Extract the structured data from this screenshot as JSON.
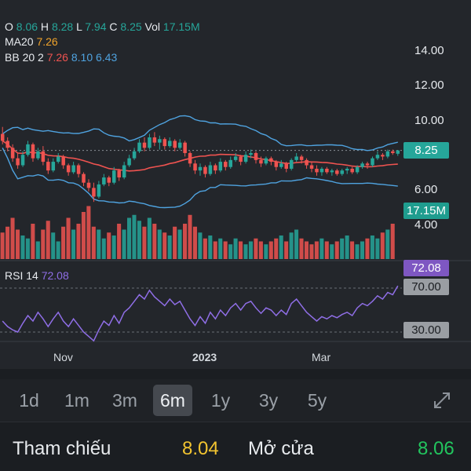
{
  "ohlc": {
    "o_label": "O",
    "o_value": "8.06",
    "h_label": "H",
    "h_value": "8.28",
    "l_label": "L",
    "l_value": "7.94",
    "c_label": "C",
    "c_value": "8.25",
    "vol_label": "Vol",
    "vol_value": "17.15M"
  },
  "ma": {
    "label": "MA20",
    "value": "7.26"
  },
  "bb": {
    "label": "BB 20 2",
    "mid": "7.26",
    "upper": "8.10",
    "lower": "6.43"
  },
  "rsi": {
    "label": "RSI 14",
    "value": "72.08"
  },
  "price_axis": [
    "14.00",
    "12.00",
    "10.00",
    "6.00",
    "4.00"
  ],
  "tags": {
    "price": "8.25",
    "volume": "17.15M",
    "rsi": "72.08",
    "rsi_upper": "70.00",
    "rsi_lower": "30.00"
  },
  "x_axis": [
    "Nov",
    "2023",
    "Mar"
  ],
  "ranges": [
    "1d",
    "1m",
    "3m",
    "6m",
    "1y",
    "3y",
    "5y"
  ],
  "active_range": "6m",
  "info": {
    "ref_label": "Tham chiếu",
    "ref_value": "8.04",
    "open_label": "Mở cửa",
    "open_value": "8.06"
  },
  "colors": {
    "up": "#26a69a",
    "down": "#ef5350",
    "ma": "#ef5350",
    "bb": "#4fa3e0",
    "rsi": "#8f6ee6",
    "price_tag": "#26a69a",
    "rsi_tag": "#7e57c2",
    "ref": "#f2c430",
    "open": "#22c55e"
  },
  "icons": {
    "expand": "expand-icon"
  },
  "chart_data": {
    "type": "candlestick",
    "title": "",
    "x_ticks": [
      "Nov",
      "2023",
      "Mar"
    ],
    "y_ticks": [
      4,
      6,
      10,
      12,
      14
    ],
    "ylim": [
      3,
      15.2
    ],
    "candles": [
      {
        "o": 9.2,
        "h": 9.6,
        "l": 8.6,
        "c": 8.8
      },
      {
        "o": 8.8,
        "h": 9.0,
        "l": 8.2,
        "c": 8.4
      },
      {
        "o": 8.4,
        "h": 8.6,
        "l": 7.6,
        "c": 7.8
      },
      {
        "o": 7.8,
        "h": 8.1,
        "l": 7.2,
        "c": 7.4
      },
      {
        "o": 7.4,
        "h": 8.2,
        "l": 7.3,
        "c": 8.0
      },
      {
        "o": 8.0,
        "h": 8.8,
        "l": 7.9,
        "c": 8.6
      },
      {
        "o": 8.6,
        "h": 8.7,
        "l": 7.6,
        "c": 7.8
      },
      {
        "o": 7.8,
        "h": 8.4,
        "l": 7.7,
        "c": 8.2
      },
      {
        "o": 8.2,
        "h": 8.5,
        "l": 7.4,
        "c": 7.6
      },
      {
        "o": 7.6,
        "h": 7.8,
        "l": 6.9,
        "c": 7.1
      },
      {
        "o": 7.1,
        "h": 7.8,
        "l": 7.0,
        "c": 7.6
      },
      {
        "o": 7.6,
        "h": 8.1,
        "l": 7.5,
        "c": 7.9
      },
      {
        "o": 7.9,
        "h": 8.0,
        "l": 7.2,
        "c": 7.4
      },
      {
        "o": 7.4,
        "h": 7.5,
        "l": 6.8,
        "c": 7.0
      },
      {
        "o": 7.0,
        "h": 7.6,
        "l": 6.9,
        "c": 7.4
      },
      {
        "o": 7.4,
        "h": 7.5,
        "l": 6.7,
        "c": 6.9
      },
      {
        "o": 6.9,
        "h": 7.0,
        "l": 6.2,
        "c": 6.4
      },
      {
        "o": 6.4,
        "h": 6.6,
        "l": 5.9,
        "c": 6.1
      },
      {
        "o": 6.1,
        "h": 6.4,
        "l": 5.3,
        "c": 5.6
      },
      {
        "o": 5.6,
        "h": 6.5,
        "l": 5.5,
        "c": 6.3
      },
      {
        "o": 6.3,
        "h": 6.9,
        "l": 6.2,
        "c": 6.7
      },
      {
        "o": 6.7,
        "h": 6.8,
        "l": 6.2,
        "c": 6.4
      },
      {
        "o": 6.4,
        "h": 7.3,
        "l": 6.3,
        "c": 7.1
      },
      {
        "o": 7.1,
        "h": 7.2,
        "l": 6.5,
        "c": 6.7
      },
      {
        "o": 6.7,
        "h": 7.6,
        "l": 6.6,
        "c": 7.4
      },
      {
        "o": 7.4,
        "h": 8.0,
        "l": 7.3,
        "c": 7.8
      },
      {
        "o": 7.8,
        "h": 8.4,
        "l": 7.7,
        "c": 8.2
      },
      {
        "o": 8.2,
        "h": 8.9,
        "l": 8.1,
        "c": 8.7
      },
      {
        "o": 8.7,
        "h": 9.0,
        "l": 8.2,
        "c": 8.4
      },
      {
        "o": 8.4,
        "h": 9.2,
        "l": 8.3,
        "c": 9.0
      },
      {
        "o": 9.0,
        "h": 9.3,
        "l": 8.5,
        "c": 8.7
      },
      {
        "o": 8.7,
        "h": 9.1,
        "l": 8.3,
        "c": 8.9
      },
      {
        "o": 8.9,
        "h": 9.0,
        "l": 8.3,
        "c": 8.5
      },
      {
        "o": 8.5,
        "h": 9.0,
        "l": 8.4,
        "c": 8.8
      },
      {
        "o": 8.8,
        "h": 8.9,
        "l": 8.2,
        "c": 8.4
      },
      {
        "o": 8.4,
        "h": 8.9,
        "l": 8.3,
        "c": 8.7
      },
      {
        "o": 8.7,
        "h": 8.8,
        "l": 7.9,
        "c": 8.1
      },
      {
        "o": 8.1,
        "h": 8.2,
        "l": 7.3,
        "c": 7.5
      },
      {
        "o": 7.5,
        "h": 7.7,
        "l": 6.9,
        "c": 7.1
      },
      {
        "o": 7.1,
        "h": 7.5,
        "l": 6.8,
        "c": 7.3
      },
      {
        "o": 7.3,
        "h": 7.4,
        "l": 6.7,
        "c": 6.9
      },
      {
        "o": 6.9,
        "h": 7.6,
        "l": 6.8,
        "c": 7.4
      },
      {
        "o": 7.4,
        "h": 7.5,
        "l": 6.9,
        "c": 7.1
      },
      {
        "o": 7.1,
        "h": 7.8,
        "l": 7.0,
        "c": 7.6
      },
      {
        "o": 7.6,
        "h": 7.7,
        "l": 7.1,
        "c": 7.3
      },
      {
        "o": 7.3,
        "h": 7.9,
        "l": 7.2,
        "c": 7.7
      },
      {
        "o": 7.7,
        "h": 8.1,
        "l": 7.6,
        "c": 7.9
      },
      {
        "o": 7.9,
        "h": 8.0,
        "l": 7.4,
        "c": 7.6
      },
      {
        "o": 7.6,
        "h": 8.2,
        "l": 7.5,
        "c": 8.0
      },
      {
        "o": 8.0,
        "h": 8.3,
        "l": 7.8,
        "c": 8.1
      },
      {
        "o": 8.1,
        "h": 8.2,
        "l": 7.5,
        "c": 7.7
      },
      {
        "o": 7.7,
        "h": 7.9,
        "l": 7.3,
        "c": 7.5
      },
      {
        "o": 7.5,
        "h": 7.9,
        "l": 7.4,
        "c": 7.8
      },
      {
        "o": 7.8,
        "h": 7.9,
        "l": 7.4,
        "c": 7.6
      },
      {
        "o": 7.6,
        "h": 7.7,
        "l": 7.1,
        "c": 7.3
      },
      {
        "o": 7.3,
        "h": 7.7,
        "l": 7.2,
        "c": 7.5
      },
      {
        "o": 7.5,
        "h": 7.6,
        "l": 7.0,
        "c": 7.2
      },
      {
        "o": 7.2,
        "h": 7.8,
        "l": 7.1,
        "c": 7.7
      },
      {
        "o": 7.7,
        "h": 8.1,
        "l": 7.6,
        "c": 7.9
      },
      {
        "o": 7.9,
        "h": 8.0,
        "l": 7.5,
        "c": 7.7
      },
      {
        "o": 7.7,
        "h": 7.8,
        "l": 7.2,
        "c": 7.4
      },
      {
        "o": 7.4,
        "h": 7.6,
        "l": 7.0,
        "c": 7.2
      },
      {
        "o": 7.2,
        "h": 7.4,
        "l": 6.8,
        "c": 7.0
      },
      {
        "o": 7.0,
        "h": 7.3,
        "l": 6.8,
        "c": 7.2
      },
      {
        "o": 7.2,
        "h": 7.3,
        "l": 6.9,
        "c": 7.0
      },
      {
        "o": 7.0,
        "h": 7.2,
        "l": 6.8,
        "c": 7.1
      },
      {
        "o": 7.1,
        "h": 7.2,
        "l": 6.8,
        "c": 6.9
      },
      {
        "o": 6.9,
        "h": 7.2,
        "l": 6.8,
        "c": 7.1
      },
      {
        "o": 7.1,
        "h": 7.3,
        "l": 6.9,
        "c": 7.2
      },
      {
        "o": 7.2,
        "h": 7.3,
        "l": 6.9,
        "c": 7.0
      },
      {
        "o": 7.0,
        "h": 7.4,
        "l": 6.9,
        "c": 7.3
      },
      {
        "o": 7.3,
        "h": 7.6,
        "l": 7.2,
        "c": 7.5
      },
      {
        "o": 7.5,
        "h": 7.6,
        "l": 7.2,
        "c": 7.4
      },
      {
        "o": 7.4,
        "h": 7.9,
        "l": 7.3,
        "c": 7.8
      },
      {
        "o": 7.8,
        "h": 8.2,
        "l": 7.7,
        "c": 8.0
      },
      {
        "o": 8.0,
        "h": 8.1,
        "l": 7.7,
        "c": 7.9
      },
      {
        "o": 7.9,
        "h": 8.3,
        "l": 7.8,
        "c": 8.2
      },
      {
        "o": 8.2,
        "h": 8.3,
        "l": 8.0,
        "c": 8.1
      },
      {
        "o": 8.06,
        "h": 8.28,
        "l": 7.94,
        "c": 8.25
      }
    ],
    "volume": [
      0.45,
      0.55,
      0.7,
      0.5,
      0.4,
      0.35,
      0.6,
      0.3,
      0.5,
      0.65,
      0.45,
      0.3,
      0.55,
      0.7,
      0.5,
      0.6,
      0.8,
      0.9,
      0.55,
      0.5,
      0.35,
      0.45,
      0.4,
      0.6,
      0.5,
      0.7,
      0.75,
      0.65,
      0.55,
      0.7,
      0.6,
      0.5,
      0.45,
      0.4,
      0.55,
      0.5,
      0.6,
      0.75,
      0.55,
      0.45,
      0.35,
      0.4,
      0.3,
      0.35,
      0.3,
      0.25,
      0.35,
      0.3,
      0.25,
      0.3,
      0.35,
      0.3,
      0.25,
      0.3,
      0.35,
      0.4,
      0.3,
      0.45,
      0.5,
      0.35,
      0.3,
      0.25,
      0.3,
      0.35,
      0.3,
      0.25,
      0.3,
      0.35,
      0.4,
      0.3,
      0.25,
      0.3,
      0.35,
      0.4,
      0.35,
      0.45,
      0.5,
      0.6
    ],
    "rsi": [
      40,
      35,
      32,
      30,
      38,
      45,
      40,
      48,
      42,
      35,
      42,
      48,
      40,
      35,
      42,
      36,
      30,
      26,
      22,
      32,
      40,
      36,
      45,
      38,
      48,
      52,
      58,
      64,
      60,
      68,
      62,
      58,
      54,
      60,
      55,
      58,
      50,
      42,
      36,
      44,
      38,
      48,
      42,
      50,
      45,
      52,
      56,
      50,
      56,
      58,
      52,
      47,
      52,
      50,
      45,
      50,
      46,
      56,
      60,
      54,
      48,
      44,
      40,
      44,
      42,
      45,
      43,
      46,
      48,
      45,
      52,
      56,
      54,
      58,
      63,
      60,
      66,
      64,
      72.08
    ],
    "rsi_levels": [
      30,
      70
    ]
  }
}
